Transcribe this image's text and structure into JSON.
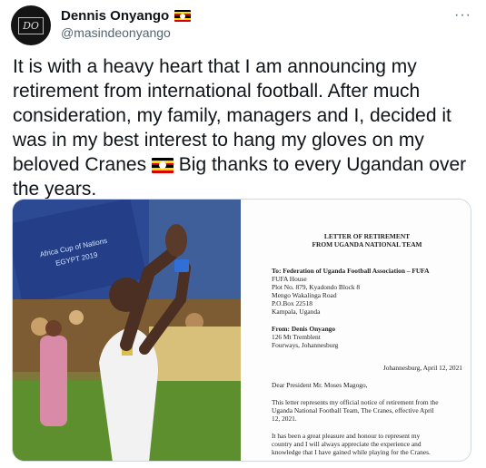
{
  "tweet": {
    "author": {
      "display_name": "Dennis Onyango",
      "handle": "@masindeonyango",
      "avatar_text": "DO",
      "badge_icon": "uganda-flag-icon"
    },
    "more_label": "···",
    "text_lines": [
      "It is with a heavy heart that I am announcing my",
      "retirement from international football. After much",
      "consideration, my family, managers and I, decided it",
      "was in my best interest to hang my gloves on my",
      "beloved Cranes",
      "Big thanks to every Ugandan over",
      "the years."
    ]
  },
  "photo": {
    "banner_lines": [
      "Africa Cup of Nations",
      "EGYPT 2019"
    ]
  },
  "letter": {
    "title_lines": [
      "LETTER OF RETIREMENT",
      "FROM UGANDA NATIONAL TEAM"
    ],
    "to_label": "To: Federation of Uganda Football Association – FUFA",
    "to_lines": [
      "FUFA House",
      "Plot No. 879, Kyadondo Block 8",
      "Mengo Wakalinga Road",
      "P.O.Box 22518",
      "Kampala, Uganda"
    ],
    "from_label": "From: Denis Onyango",
    "from_lines": [
      "126 Mt Tremblent",
      "Fourways, Johannesburg"
    ],
    "date": "Johannesburg, April 12, 2021",
    "salutation": "Dear President Mr. Moses Magogo,",
    "para1": [
      "This letter represents my official notice of retirement from the",
      "Uganda National Football Team, The Cranes, effective April",
      "12, 2021."
    ],
    "para2": [
      "It has been a great pleasure and honour to represent my",
      "country and I will always appreciate the experience and",
      "knowledge that I have gained while playing for the Cranes."
    ]
  },
  "colors": {
    "flag_black": "#000000",
    "flag_yellow": "#FCDC04",
    "flag_red": "#D90000",
    "handle_gray": "#536471",
    "border": "#cfd9de"
  }
}
